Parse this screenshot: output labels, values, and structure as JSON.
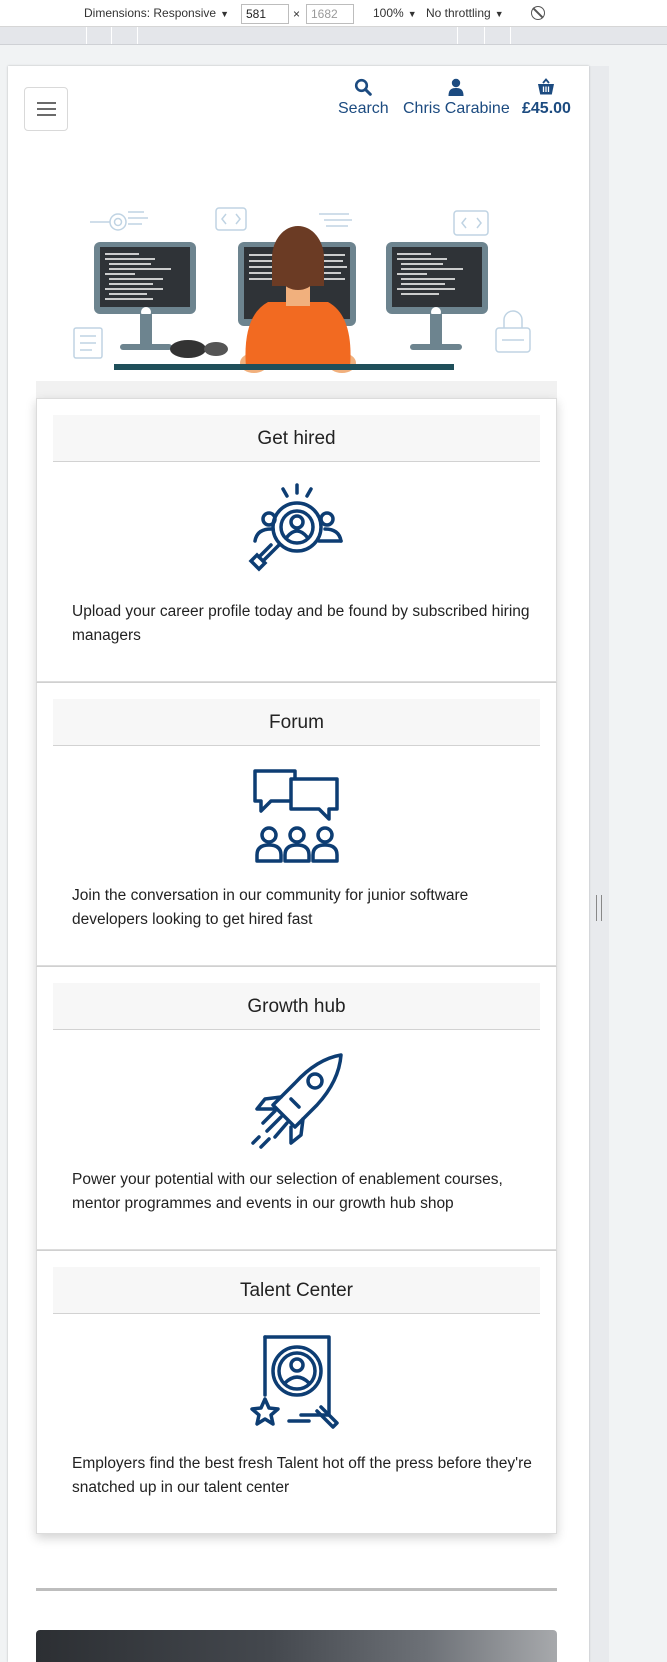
{
  "devtools": {
    "dimensions_label": "Dimensions: Responsive",
    "width_value": "581",
    "height_value": "1682",
    "times": "×",
    "zoom": "100%",
    "throttling": "No throttling",
    "caret": "▼"
  },
  "header": {
    "menu_icon": "hamburger-menu-icon",
    "search_label": "Search",
    "search_icon": "search-icon",
    "account_label": "Chris Carabine",
    "account_icon": "user-icon",
    "basket_total": "£45.00",
    "basket_icon": "basket-icon"
  },
  "hero": {
    "illustration": "developer-at-three-monitors-illustration"
  },
  "cards": [
    {
      "title": "Get hired",
      "icon": "magnifier-person-icon",
      "text": "Upload your career profile today and be found by subscribed hiring managers"
    },
    {
      "title": "Forum",
      "icon": "chat-community-icon",
      "text": "Join the conversation in our community for junior software developers looking to get hired fast"
    },
    {
      "title": "Growth hub",
      "icon": "rocket-icon",
      "text": "Power your potential with our selection of enablement courses, mentor programmes and events in our growth hub shop"
    },
    {
      "title": "Talent Center",
      "icon": "talent-badge-icon",
      "text": "Employers find the best fresh Talent hot off the press before they're snatched up in our talent center"
    }
  ],
  "colors": {
    "brand_blue": "#0d3d73",
    "nav_text": "#1c4b80",
    "hero_orange": "#f26a21",
    "card_header_bg": "#f7f7f7"
  }
}
